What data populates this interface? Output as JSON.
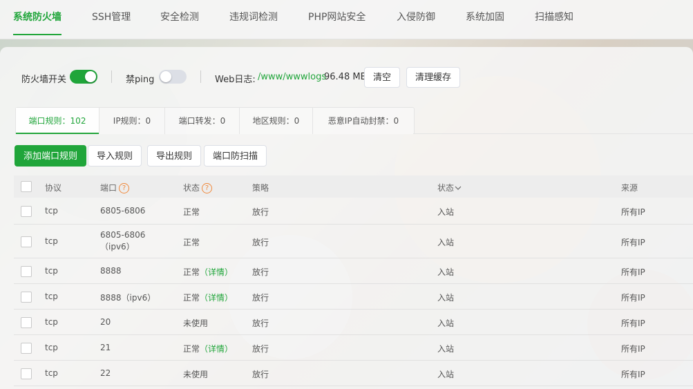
{
  "nav": {
    "tabs": [
      {
        "label": "系统防火墙"
      },
      {
        "label": "SSH管理"
      },
      {
        "label": "安全检测"
      },
      {
        "label": "违规词检测"
      },
      {
        "label": "PHP网站安全"
      },
      {
        "label": "入侵防御"
      },
      {
        "label": "系统加固"
      },
      {
        "label": "扫描感知"
      }
    ]
  },
  "controls": {
    "firewall_label": "防火墙开关",
    "firewall_on": true,
    "ping_label": "禁ping",
    "ping_on": false,
    "weblog_label": "Web日志:",
    "weblog_path": "/www/wwwlogs",
    "weblog_size": "96.48 MB",
    "clear_button": "清空",
    "clear_cache_button": "清理缓存"
  },
  "rule_tabs": [
    {
      "label": "端口规则：102"
    },
    {
      "label": "IP规则：0"
    },
    {
      "label": "端口转发：0"
    },
    {
      "label": "地区规则：0"
    },
    {
      "label": "恶意IP自动封禁：0"
    }
  ],
  "actions": {
    "add": "添加端口规则",
    "import": "导入规则",
    "export": "导出规则",
    "scan": "端口防扫描"
  },
  "table": {
    "headers": {
      "protocol": "协议",
      "port": "端口",
      "status": "状态",
      "policy": "策略",
      "direction": "状态",
      "source": "来源"
    },
    "rows": [
      {
        "protocol": "tcp",
        "port": "6805-6806",
        "status": "正常",
        "detail": "",
        "policy": "放行",
        "direction": "入站",
        "source": "所有IP"
      },
      {
        "protocol": "tcp",
        "port": "6805-6806（ipv6）",
        "status": "正常",
        "detail": "",
        "policy": "放行",
        "direction": "入站",
        "source": "所有IP"
      },
      {
        "protocol": "tcp",
        "port": "8888",
        "status": "正常",
        "detail": "（详情）",
        "policy": "放行",
        "direction": "入站",
        "source": "所有IP"
      },
      {
        "protocol": "tcp",
        "port": "8888（ipv6）",
        "status": "正常",
        "detail": "（详情）",
        "policy": "放行",
        "direction": "入站",
        "source": "所有IP"
      },
      {
        "protocol": "tcp",
        "port": "20",
        "status": "未使用",
        "detail": "",
        "policy": "放行",
        "direction": "入站",
        "source": "所有IP"
      },
      {
        "protocol": "tcp",
        "port": "21",
        "status": "正常",
        "detail": "（详情）",
        "policy": "放行",
        "direction": "入站",
        "source": "所有IP"
      },
      {
        "protocol": "tcp",
        "port": "22",
        "status": "未使用",
        "detail": "",
        "policy": "放行",
        "direction": "入站",
        "source": "所有IP"
      }
    ]
  },
  "colors": {
    "accent": "#20a53a",
    "help": "#f0883a"
  }
}
